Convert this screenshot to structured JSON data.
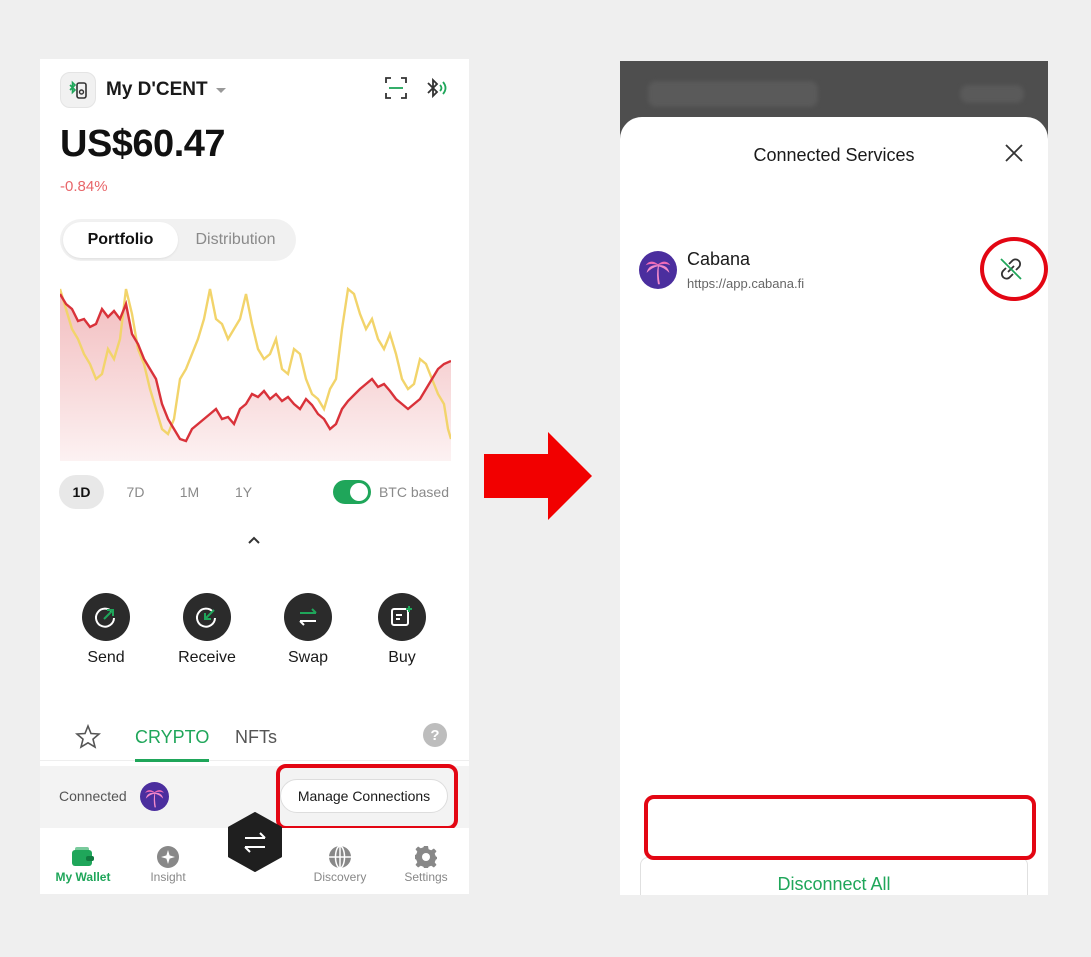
{
  "left": {
    "wallet_name": "My D'CENT",
    "balance": "US$60.47",
    "change": "-0.84%",
    "segments": [
      "Portfolio",
      "Distribution"
    ],
    "ranges": [
      "1D",
      "7D",
      "1M",
      "1Y"
    ],
    "btc_toggle_label": "BTC based",
    "actions": [
      "Send",
      "Receive",
      "Swap",
      "Buy"
    ],
    "tabs": {
      "crypto": "CRYPTO",
      "nfts": "NFTs",
      "help": "?"
    },
    "connected_label": "Connected",
    "manage_label": "Manage Connections",
    "nav": [
      "My Wallet",
      "Insight",
      "Discovery",
      "Settings"
    ]
  },
  "right": {
    "title": "Connected Services",
    "service_name": "Cabana",
    "service_url": "https://app.cabana.fi",
    "disconnect_label": "Disconnect All"
  },
  "colors": {
    "accent": "#1fa65a",
    "highlight": "#e30613",
    "negative": "#e8666a",
    "line_red": "#d9323a",
    "line_yellow": "#f2d46b"
  }
}
